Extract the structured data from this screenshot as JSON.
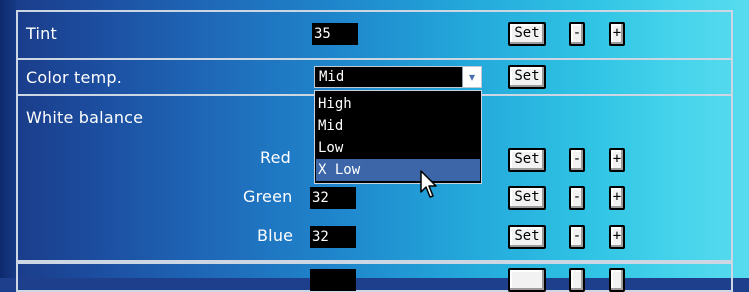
{
  "rows": {
    "tint": {
      "label": "Tint",
      "value": "35",
      "set": "Set",
      "minus": "-",
      "plus": "+"
    },
    "color_temp": {
      "label": "Color temp.",
      "selected": "Mid",
      "set": "Set"
    },
    "white_balance": {
      "label": "White balance",
      "red": {
        "label": "Red",
        "set": "Set",
        "minus": "-",
        "plus": "+"
      },
      "green": {
        "label": "Green",
        "value": "32",
        "set": "Set",
        "minus": "-",
        "plus": "+"
      },
      "blue": {
        "label": "Blue",
        "value": "32",
        "set": "Set",
        "minus": "-",
        "plus": "+"
      }
    }
  },
  "dropdown": {
    "options": [
      "High",
      "Mid",
      "Low",
      "X Low"
    ],
    "highlighted": "X Low"
  },
  "icons": {
    "select_arrow": "chevron-down-icon",
    "cursor": "mouse-pointer-icon"
  },
  "colors": {
    "highlight": "#3c66a8",
    "field_bg": "#000000"
  }
}
